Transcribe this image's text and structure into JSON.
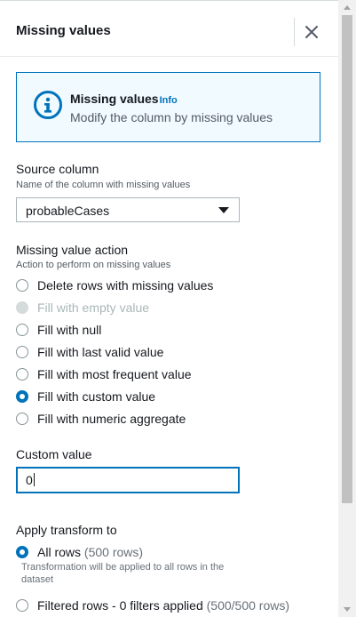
{
  "panel": {
    "title": "Missing values"
  },
  "info": {
    "title": "Missing values",
    "link": "Info",
    "description": "Modify the column by missing values"
  },
  "source_column": {
    "label": "Source column",
    "description": "Name of the column with missing values",
    "selected": "probableCases"
  },
  "missing_action": {
    "label": "Missing value action",
    "description": "Action to perform on missing values",
    "options": [
      {
        "label": "Delete rows with missing values",
        "state": "unchecked"
      },
      {
        "label": "Fill with empty value",
        "state": "disabled"
      },
      {
        "label": "Fill with null",
        "state": "unchecked"
      },
      {
        "label": "Fill with last valid value",
        "state": "unchecked"
      },
      {
        "label": "Fill with most frequent value",
        "state": "unchecked"
      },
      {
        "label": "Fill with custom value",
        "state": "checked"
      },
      {
        "label": "Fill with numeric aggregate",
        "state": "unchecked"
      }
    ]
  },
  "custom_value": {
    "label": "Custom value",
    "value": "0"
  },
  "apply_transform": {
    "label": "Apply transform to",
    "all_rows": {
      "label": "All rows",
      "count": "(500 rows)",
      "description": "Transformation will be applied to all rows in the dataset",
      "state": "checked"
    },
    "filtered_rows": {
      "label": "Filtered rows - 0 filters applied",
      "count": "(500/500 rows)",
      "state": "unchecked"
    }
  },
  "colors": {
    "accent": "#0073bb",
    "info_bg": "#f1faff",
    "text": "#16191f",
    "muted": "#545b64"
  }
}
